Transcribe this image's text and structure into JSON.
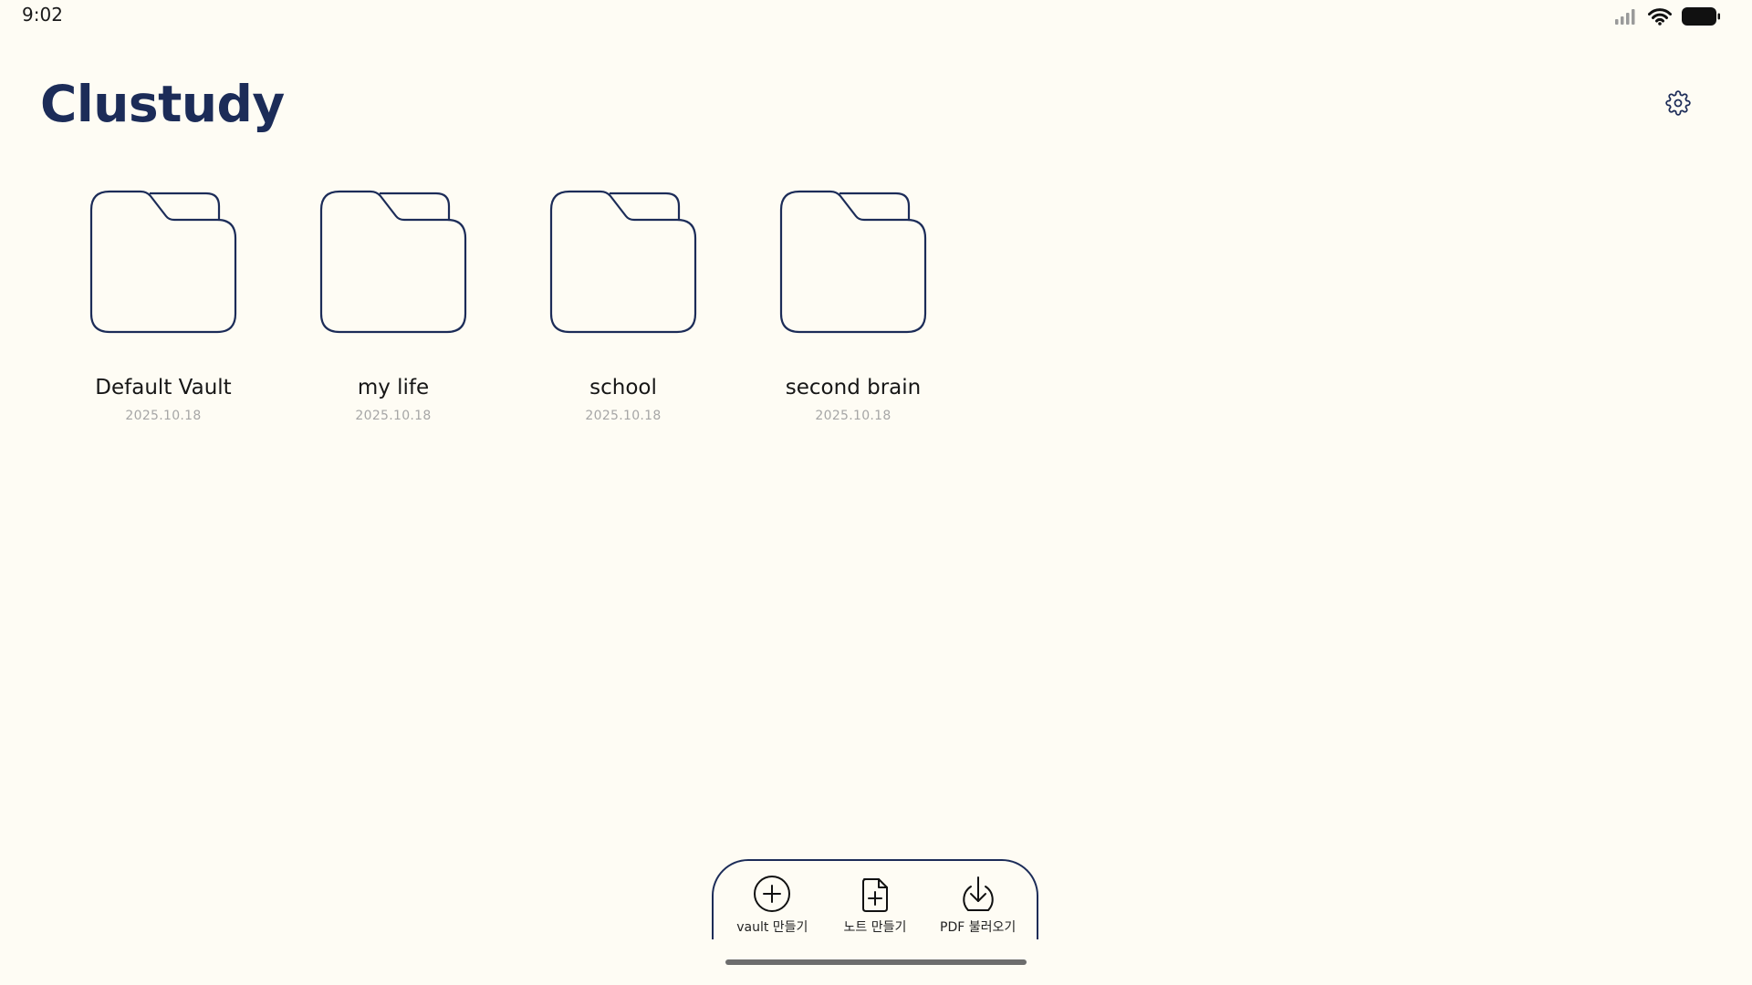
{
  "status_bar": {
    "time": "9:02",
    "icons": [
      "cellular-signal-icon",
      "wifi-icon",
      "battery-icon"
    ]
  },
  "header": {
    "title": "Clustudy",
    "settings_icon": "gear-icon"
  },
  "vaults": [
    {
      "name": "Default Vault",
      "date": "2025.10.18",
      "icon": "folder-icon"
    },
    {
      "name": "my life",
      "date": "2025.10.18",
      "icon": "folder-icon"
    },
    {
      "name": "school",
      "date": "2025.10.18",
      "icon": "folder-icon"
    },
    {
      "name": "second brain",
      "date": "2025.10.18",
      "icon": "folder-icon"
    }
  ],
  "bottom_bar": {
    "actions": [
      {
        "label": "vault 만들기",
        "icon": "plus-circle-icon"
      },
      {
        "label": "노트 만들기",
        "icon": "file-plus-icon"
      },
      {
        "label": "PDF 불러오기",
        "icon": "download-icon"
      }
    ]
  },
  "colors": {
    "background": "#fefcf4",
    "accent": "#1c2c58",
    "text": "#161616",
    "muted_text": "#a6a6a6"
  }
}
